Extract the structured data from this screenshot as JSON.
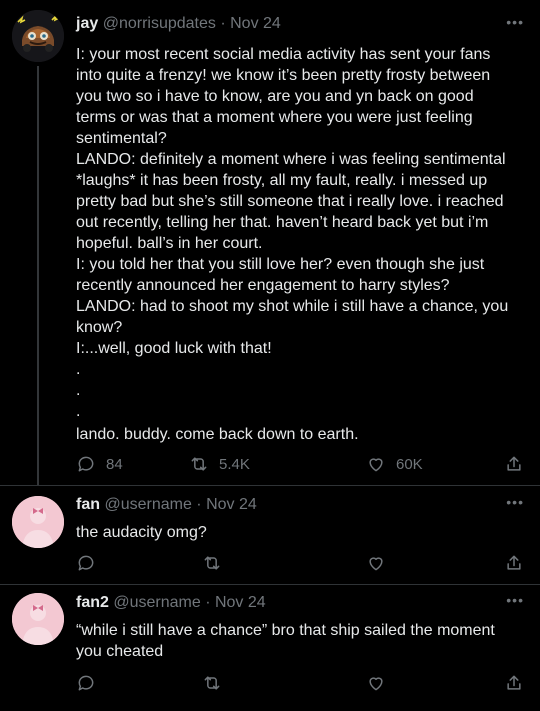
{
  "tweets": [
    {
      "name": "jay",
      "handle": "@norrisupdates",
      "date": "· Nov 24",
      "lines": [
        "I: your most recent social media activity has sent your fans into quite a frenzy! we know it’s been pretty frosty between you two so i have to know, are you and yn back on good terms or was that a moment where you were just feeling sentimental?",
        "LANDO: definitely a moment where i was feeling sentimental *laughs* it has been frosty, all my fault, really. i messed up pretty bad but she’s still someone that i really love. i reached out recently, telling her that. haven’t heard back yet but i’m hopeful. ball’s in her court.",
        "I: you told her that you still love her? even though she just recently announced her engagement to harry styles?",
        "LANDO: had to shoot my shot while i still have a chance, you know?",
        "I:...well, good luck with that!",
        ".",
        ".",
        ".",
        "lando. buddy. come back down to earth."
      ],
      "replies": "84",
      "retweets": "5.4K",
      "likes": "60K"
    },
    {
      "name": "fan",
      "handle": "@username",
      "date": "· Nov 24",
      "text": "the audacity omg?"
    },
    {
      "name": "fan2",
      "handle": "@username",
      "date": "· Nov 24",
      "text": "“while i still have a chance” bro that ship sailed the moment you cheated"
    }
  ],
  "icons": {
    "more": "more-horizontal-icon",
    "reply": "reply-icon",
    "retweet": "retweet-icon",
    "like": "heart-icon",
    "share": "share-icon",
    "more_glyph": "•••"
  },
  "colors": {
    "background": "#000000",
    "text": "#e7e9ea",
    "muted": "#71767b",
    "avatar_pink": "#f3c8d2",
    "avatar_main_bg": "#1c1c1e"
  }
}
